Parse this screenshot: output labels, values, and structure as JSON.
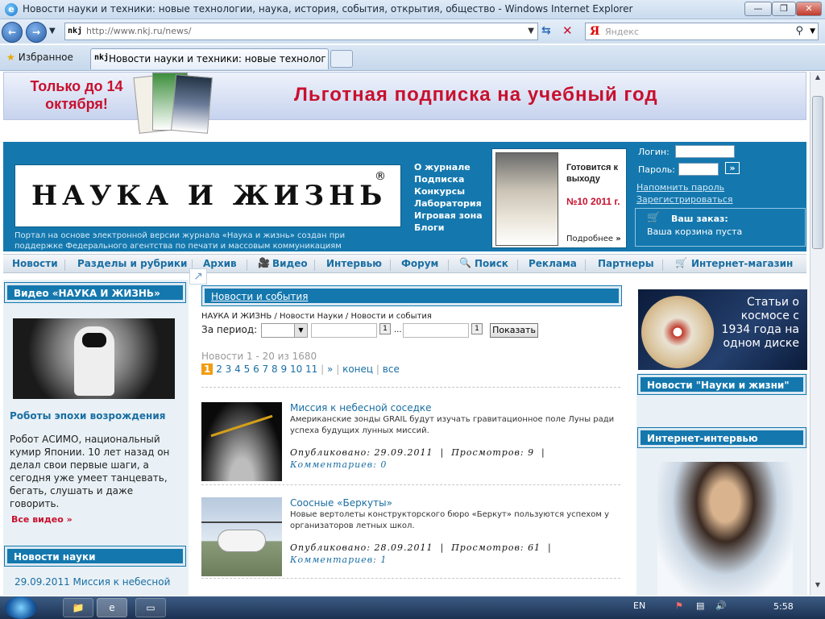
{
  "window": {
    "title": "Новости науки и техники: новые технологии, наука, история, события, открытия, общество - Windows Internet Explorer",
    "min": "—",
    "max": "❐",
    "close": "✕"
  },
  "browser": {
    "url_prefix": "http://www.nkj.ru/news/",
    "favicon": "nkj",
    "search_logo": "Я",
    "search_placeholder": "Яндекс",
    "favorites": "Избранное",
    "tab_title": "Новости науки и техники: новые технологии, ..."
  },
  "banner": {
    "left": "Только до 14 октября!",
    "right": "Льготная подписка на учебный год"
  },
  "header": {
    "logo": "НАУКА И ЖИЗНЬ",
    "reg": "®",
    "portal": "Портал на основе электронной версии журнала «Наука и жизнь» создан при поддержке Федерального агентства по печати и массовым коммуникациям",
    "links": [
      "О журнале",
      "Подписка",
      "Конкурсы",
      "Лаборатория",
      "Игровая зона",
      "Блоги"
    ],
    "mag": {
      "prep": "Готовится к выходу",
      "issue": "№10 2011 г.",
      "more": "Подробнее"
    },
    "login_label": "Логин:",
    "password_label": "Пароль:",
    "submit": "»",
    "remind": "Напомнить пароль",
    "register": "Зарегистрироваться",
    "order_title": "Ваш заказ:",
    "order_status": "Ваша корзина пуста"
  },
  "menu": [
    "Новости",
    "Разделы и рубрики",
    "Архив",
    "Видео",
    "Интервью",
    "Форум",
    "Поиск",
    "Реклама",
    "Партнеры",
    "Интернет-магазин"
  ],
  "left": {
    "video_hd": "Видео «НАУКА И ЖИЗНЬ»",
    "video_title": "Роботы эпохи возрождения",
    "video_text": "Робот АСИМО, национальный кумир Японии. 10 лет назад он делал свои первые шаги, а сегодня уже умеет танцевать, бегать, слушать и даже говорить.",
    "all_video": "Все видео »",
    "news_hd": "Новости науки",
    "news_date": "29.09.2011",
    "news_text": "Миссия к небесной"
  },
  "center": {
    "section": "Новости и события",
    "crumb": "НАУКА И ЖИЗНЬ / Новости Науки / Новости и события",
    "period": "За период:",
    "show": "Показать",
    "dots": "...",
    "cal": "1",
    "count": "Новости 1 - 20 из 1680",
    "pages": [
      "1",
      "2",
      "3",
      "4",
      "5",
      "6",
      "7",
      "8",
      "9",
      "10",
      "11"
    ],
    "next": "»",
    "end": "конец",
    "all": "все",
    "items": [
      {
        "title": "Миссия к небесной соседке",
        "text": "Американские зонды GRAIL будут изучать гравитационное поле Луны ради успеха будущих лунных миссий.",
        "pub": "Опубликовано: 29.09.2011",
        "views": "Просмотров: 9",
        "comments": "Комментариев: 0"
      },
      {
        "title": "Соосные «Беркуты»",
        "text": "Новые вертолеты конструкторского бюро «Беркут» пользуются успехом у организаторов летных школ.",
        "pub": "Опубликовано: 28.09.2011",
        "views": "Просмотров: 61",
        "comments": "Комментариев: 1"
      }
    ]
  },
  "right": {
    "disk": "Статьи о космосе с 1934 года на одном диске",
    "news_hd": "Новости \"Науки и жизни\"",
    "interview_hd": "Интернет-интервью"
  },
  "taskbar": {
    "lang": "EN",
    "time": "5:58"
  }
}
